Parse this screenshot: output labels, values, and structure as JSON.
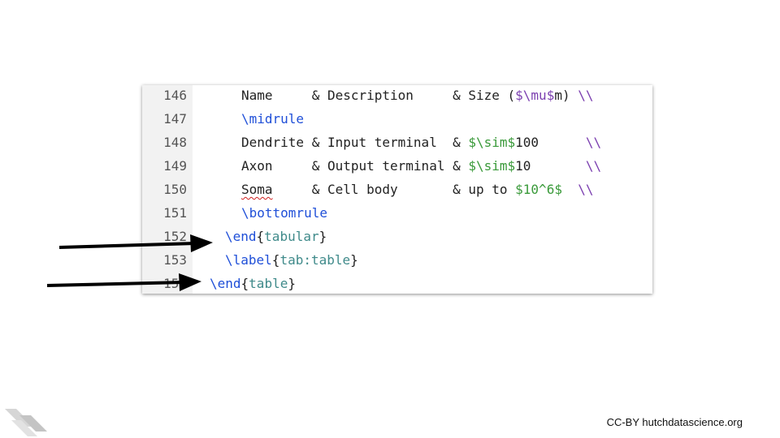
{
  "editor": {
    "lines": [
      {
        "number": "146",
        "segments": [
          {
            "text": "Name     & Description     & Size (",
            "style": "plain"
          },
          {
            "text": "$\\mu$",
            "style": "mu"
          },
          {
            "text": "m) ",
            "style": "plain"
          },
          {
            "text": "\\\\",
            "style": "bs"
          }
        ]
      },
      {
        "number": "147",
        "segments": [
          {
            "text": "\\midrule",
            "style": "cmd"
          }
        ]
      },
      {
        "number": "148",
        "segments": [
          {
            "text": "Dendrite & Input terminal  & ",
            "style": "plain"
          },
          {
            "text": "$\\sim$",
            "style": "math"
          },
          {
            "text": "100      ",
            "style": "plain"
          },
          {
            "text": "\\\\",
            "style": "bs"
          }
        ]
      },
      {
        "number": "149",
        "segments": [
          {
            "text": "Axon     & Output terminal & ",
            "style": "plain"
          },
          {
            "text": "$\\sim$",
            "style": "math"
          },
          {
            "text": "10       ",
            "style": "plain"
          },
          {
            "text": "\\\\",
            "style": "bs"
          }
        ]
      },
      {
        "number": "150",
        "segments": [
          {
            "text": "Soma",
            "style": "squiggle"
          },
          {
            "text": "     & Cell body       & up to ",
            "style": "plain"
          },
          {
            "text": "$10^6$",
            "style": "math"
          },
          {
            "text": "  ",
            "style": "plain"
          },
          {
            "text": "\\\\",
            "style": "bs"
          }
        ]
      },
      {
        "number": "151",
        "segments": [
          {
            "text": "\\bottomrule",
            "style": "cmd"
          }
        ]
      },
      {
        "number": "152",
        "segments": [
          {
            "text": "\\end",
            "style": "cmd"
          },
          {
            "text": "{",
            "style": "brace"
          },
          {
            "text": "tabular",
            "style": "arg"
          },
          {
            "text": "}",
            "style": "brace"
          }
        ]
      },
      {
        "number": "153",
        "segments": [
          {
            "text": "\\label",
            "style": "cmd"
          },
          {
            "text": "{",
            "style": "brace"
          },
          {
            "text": "tab:table",
            "style": "arg"
          },
          {
            "text": "}",
            "style": "brace"
          }
        ]
      },
      {
        "number": "154",
        "segments": [
          {
            "text": "\\end",
            "style": "cmd"
          },
          {
            "text": "{",
            "style": "brace"
          },
          {
            "text": "table",
            "style": "arg"
          },
          {
            "text": "}",
            "style": "brace"
          }
        ]
      }
    ]
  },
  "colors": {
    "command": "#1f4fd8",
    "argument": "#3f8a8a",
    "math": "#3a9a3a",
    "special": "#7b3fb0",
    "arrow": "#000000"
  },
  "icons": [
    "arrow-pointer-icon",
    "hutch-logo-icon"
  ],
  "footer": {
    "credit": "CC-BY hutchdatascience.org"
  }
}
